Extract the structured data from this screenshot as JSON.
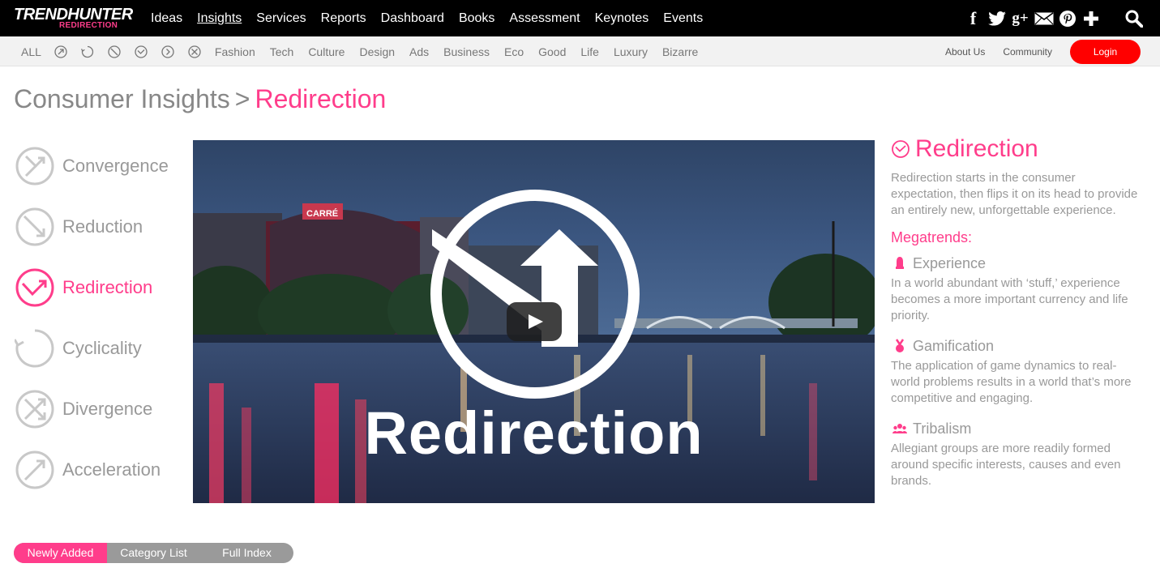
{
  "header": {
    "logo_main": "TRENDHUNTER",
    "logo_sub": "REDIRECTION",
    "nav": [
      "Ideas",
      "Insights",
      "Services",
      "Reports",
      "Dashboard",
      "Books",
      "Assessment",
      "Keynotes",
      "Events"
    ],
    "active_nav": "Insights",
    "social_icons": [
      "facebook-icon",
      "twitter-icon",
      "google-plus-icon",
      "email-icon",
      "pinterest-icon",
      "plus-icon"
    ],
    "facebook_glyph": "f",
    "google_plus_glyph": "g+"
  },
  "subnav": {
    "all_label": "ALL",
    "trend_icons": [
      "convergence-icon",
      "cyclicality-icon",
      "reduction-icon",
      "redirection-icon",
      "acceleration-icon",
      "divergence-icon"
    ],
    "categories": [
      "Fashion",
      "Tech",
      "Culture",
      "Design",
      "Ads",
      "Business",
      "Eco",
      "Good",
      "Life",
      "Luxury",
      "Bizarre"
    ],
    "about_us": "About Us",
    "community": "Community",
    "login": "Login"
  },
  "breadcrumb": {
    "parent": "Consumer Insights",
    "separator": ">",
    "current": "Redirection"
  },
  "trends": [
    {
      "label": "Convergence",
      "icon": "convergence-icon",
      "active": false
    },
    {
      "label": "Reduction",
      "icon": "reduction-icon",
      "active": false
    },
    {
      "label": "Redirection",
      "icon": "redirection-icon",
      "active": true
    },
    {
      "label": "Cyclicality",
      "icon": "cyclicality-icon",
      "active": false
    },
    {
      "label": "Divergence",
      "icon": "divergence-icon",
      "active": false
    },
    {
      "label": "Acceleration",
      "icon": "acceleration-icon",
      "active": false
    }
  ],
  "video": {
    "overlay_title": "Redirection",
    "sign_text": "CARRÉ"
  },
  "panel": {
    "title": "Redirection",
    "description": "Redirection starts in the consumer expectation, then flips it on its head to provide an entirely new, unforgettable experience.",
    "megatrends_label": "Megatrends:",
    "megatrends": [
      {
        "name": "Experience",
        "icon": "experience-icon",
        "description": "In a world abundant with ‘stuff,’ experience becomes a more important currency and life priority."
      },
      {
        "name": "Gamification",
        "icon": "medal-icon",
        "description": "The application of game dynamics to real-world problems results in a world that’s more competitive and engaging."
      },
      {
        "name": "Tribalism",
        "icon": "group-icon",
        "description": "Allegiant groups are more readily formed around specific interests, causes and even brands."
      }
    ]
  },
  "tabs": {
    "newly_added": "Newly Added",
    "category_list": "Category List",
    "full_index": "Full Index"
  },
  "colors": {
    "accent_pink": "#ff3d8b",
    "login_red": "#ff0000",
    "topbar": "#000000"
  }
}
